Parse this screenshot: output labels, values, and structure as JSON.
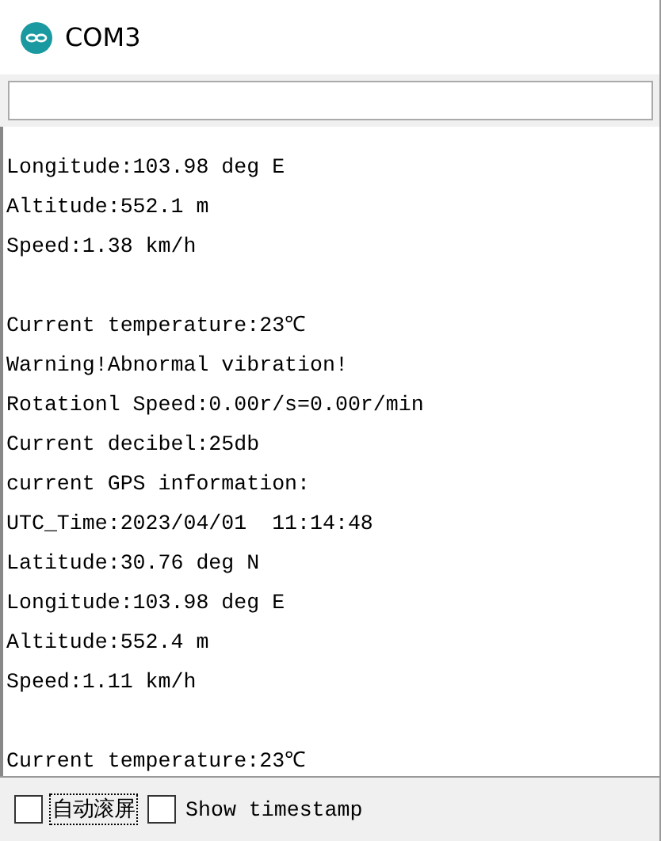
{
  "window": {
    "title": "COM3"
  },
  "output_lines": [
    {
      "kind": "text",
      "text": "Longitude:103.98 deg E"
    },
    {
      "kind": "text",
      "text": "Altitude:552.1 m"
    },
    {
      "kind": "text",
      "text": "Speed:1.38 km/h"
    },
    {
      "kind": "blank"
    },
    {
      "kind": "text",
      "text": "Current temperature:23℃"
    },
    {
      "kind": "text",
      "text": "Warning!Abnormal vibration!"
    },
    {
      "kind": "text",
      "text": "Rotationl Speed:0.00r/s=0.00r/min"
    },
    {
      "kind": "text",
      "text": "Current decibel:25db"
    },
    {
      "kind": "text",
      "text": "current GPS information:"
    },
    {
      "kind": "text",
      "text": "UTC_Time:2023/04/01  11:14:48"
    },
    {
      "kind": "text",
      "text": "Latitude:30.76 deg N"
    },
    {
      "kind": "text",
      "text": "Longitude:103.98 deg E"
    },
    {
      "kind": "text",
      "text": "Altitude:552.4 m"
    },
    {
      "kind": "text",
      "text": "Speed:1.11 km/h"
    },
    {
      "kind": "blank"
    },
    {
      "kind": "text",
      "text": "Current temperature:23℃"
    }
  ],
  "options": [
    {
      "label": "自动滚屏",
      "checked": false,
      "focused": true
    },
    {
      "label": "Show timestamp",
      "checked": false,
      "focused": false
    }
  ]
}
